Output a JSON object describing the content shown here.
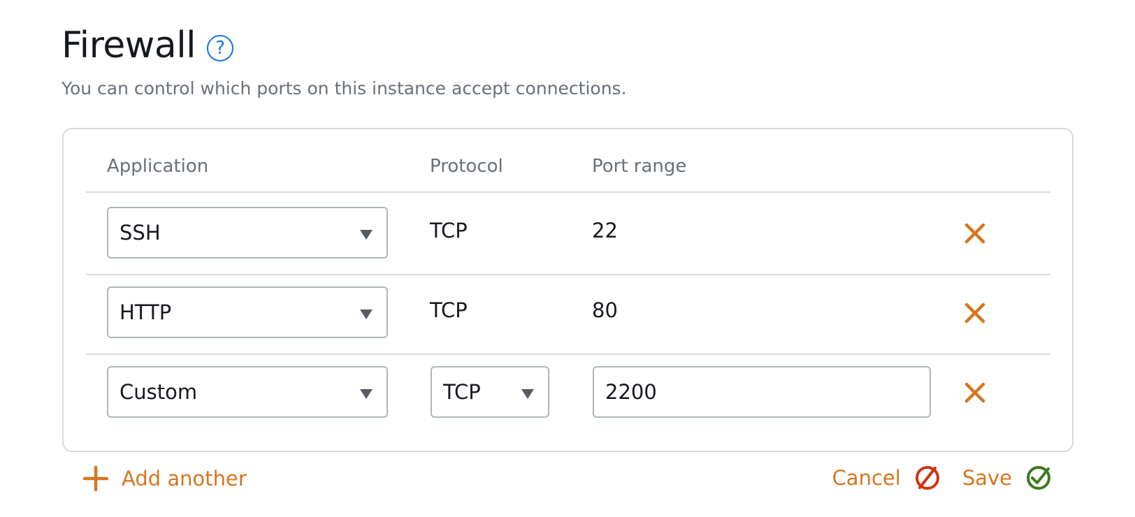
{
  "header": {
    "title": "Firewall",
    "help_glyph": "?",
    "subtitle": "You can control which ports on this instance accept connections."
  },
  "table": {
    "columns": [
      "Application",
      "Protocol",
      "Port range"
    ],
    "rows": [
      {
        "application": "SSH",
        "protocol": "TCP",
        "port_range": "22"
      },
      {
        "application": "HTTP",
        "protocol": "TCP",
        "port_range": "80"
      },
      {
        "application": "Custom",
        "protocol": "TCP",
        "port_range": "2200"
      }
    ]
  },
  "footer": {
    "add_label": "Add another",
    "cancel_label": "Cancel",
    "save_label": "Save"
  },
  "icons": {
    "help": "help-circle-icon",
    "dropdown": "caret-down-icon",
    "remove": "close-x-icon",
    "add": "plus-icon",
    "cancel": "prohibited-icon",
    "save": "check-circle-icon"
  },
  "colors": {
    "accent_orange": "#d5761f",
    "help_blue": "#0f73e0",
    "cancel_red": "#d13212",
    "save_green": "#3b7a1c",
    "border": "#aab7b8",
    "divider": "#d5dbdb",
    "muted_text": "#687078"
  }
}
